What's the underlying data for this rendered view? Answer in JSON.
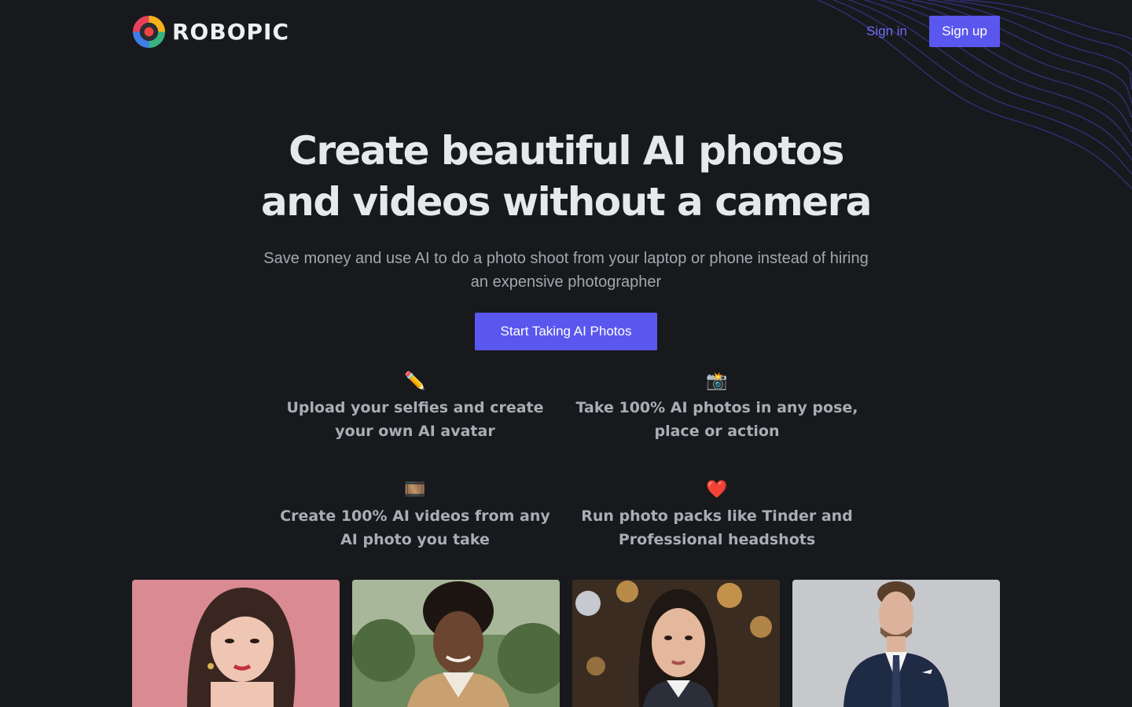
{
  "brand": {
    "name": "ROBOPIC",
    "logo_icon": "robopic-logo-icon"
  },
  "nav": {
    "sign_in": "Sign in",
    "sign_up": "Sign up"
  },
  "hero": {
    "title": "Create beautiful AI photos and videos without a camera",
    "subtitle": "Save money and use AI to do a photo shoot from your laptop or phone instead of hiring an expensive photographer",
    "cta": "Start Taking AI Photos"
  },
  "features": [
    {
      "icon": "✏️",
      "icon_name": "pencil-icon",
      "text": "Upload your selfies and create your own AI avatar"
    },
    {
      "icon": "📸",
      "icon_name": "camera-flash-icon",
      "text": "Take 100% AI photos in any pose, place or action"
    },
    {
      "icon": "🎞️",
      "icon_name": "film-frames-icon",
      "text": "Create 100% AI videos from any AI photo you take"
    },
    {
      "icon": "❤️",
      "icon_name": "heart-icon",
      "text": "Run photo packs like Tinder and Professional headshots"
    }
  ],
  "colors": {
    "background": "#18191c",
    "accent": "#5a57ee",
    "link": "#6f6ef5"
  }
}
